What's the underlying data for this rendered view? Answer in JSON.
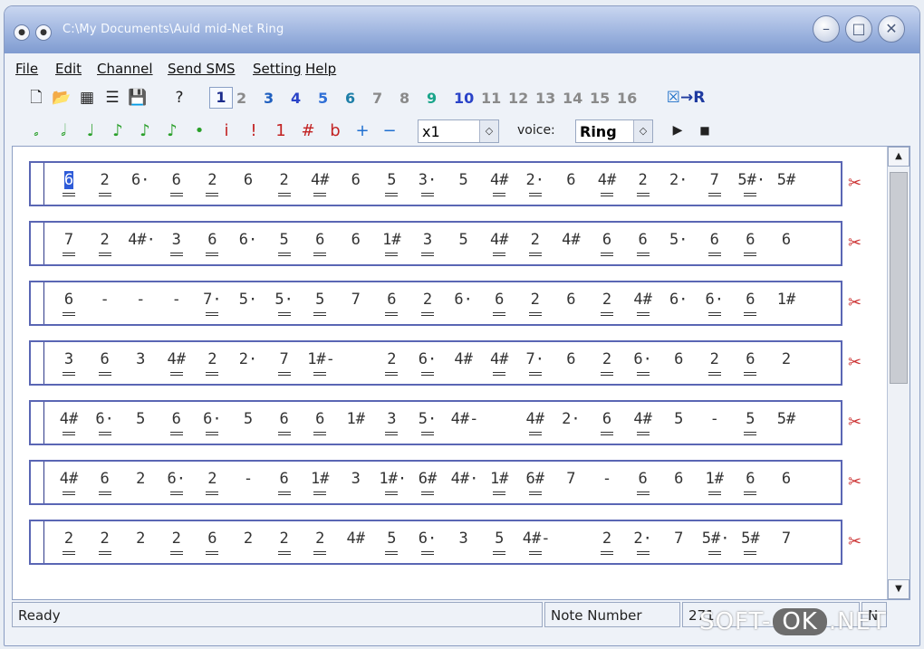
{
  "window": {
    "title": "C:\\My Documents\\Auld mid-Net Ring"
  },
  "menu": [
    "File",
    "Edit",
    "Channel",
    "Send SMS",
    "Setting",
    "Help"
  ],
  "toolbar": {
    "icons": [
      "new-icon",
      "open-icon",
      "calendar-icon",
      "list-icon",
      "save-icon",
      "help-icon"
    ],
    "channels": [
      {
        "label": "1",
        "color": "#1c2c8c"
      },
      {
        "label": "2",
        "color": "#8a8a8a"
      },
      {
        "label": "3",
        "color": "#1f5fbf"
      },
      {
        "label": "4",
        "color": "#2a43c8"
      },
      {
        "label": "5",
        "color": "#2f6fd6"
      },
      {
        "label": "6",
        "color": "#1e7fa8"
      },
      {
        "label": "7",
        "color": "#8a8a8a"
      },
      {
        "label": "8",
        "color": "#8a8a8a"
      },
      {
        "label": "9",
        "color": "#1aa58a"
      },
      {
        "label": "10",
        "color": "#2a43c8"
      },
      {
        "label": "11",
        "color": "#8a8a8a"
      },
      {
        "label": "12",
        "color": "#8a8a8a"
      },
      {
        "label": "13",
        "color": "#8a8a8a"
      },
      {
        "label": "14",
        "color": "#8a8a8a"
      },
      {
        "label": "15",
        "color": "#8a8a8a"
      },
      {
        "label": "16",
        "color": "#8a8a8a"
      }
    ],
    "transfer_label": "→R"
  },
  "notes_toolbar": {
    "note_symbols": [
      "𝅗",
      "𝅗𝅥",
      "♩",
      "♪",
      "♪",
      "♪",
      "•",
      "i",
      "!",
      "1",
      "#",
      "b",
      "+",
      "−"
    ],
    "note_colors": [
      "#2aa02a",
      "#2aa02a",
      "#2aa02a",
      "#2aa02a",
      "#2aa02a",
      "#2aa02a",
      "#2aa02a",
      "#c22222",
      "#c22222",
      "#c22222",
      "#c22222",
      "#c22222",
      "#1f6fd0",
      "#1f6fd0"
    ],
    "multiplier": "x1",
    "voice_label": "voice:",
    "voice_value": "Ring"
  },
  "score": {
    "rows": [
      [
        "6",
        "2",
        "6·",
        "6",
        "2",
        "6",
        "2",
        "4#",
        "6",
        "5",
        "3·",
        "5",
        "4#",
        "2·",
        "6",
        "4#",
        "2",
        "2·",
        "7",
        "5#·",
        "5#"
      ],
      [
        "7",
        "2",
        "4#·",
        "3",
        "6",
        "6·",
        "5",
        "6",
        "6",
        "1#",
        "3",
        "5",
        "4#",
        "2",
        "4#",
        "6",
        "6",
        "5·",
        "6",
        "6",
        "6"
      ],
      [
        "6",
        "-",
        "-",
        "-",
        "7·",
        "5·",
        "5·",
        "5",
        "7",
        "6",
        "2",
        "6·",
        "6",
        "2",
        "6",
        "2",
        "4#",
        "6·",
        "6·",
        "6",
        "1#"
      ],
      [
        "3",
        "6",
        "3",
        "4#",
        "2",
        "2·",
        "7",
        "1#-",
        "",
        "2",
        "6·",
        "4#",
        "4#",
        "7·",
        "6",
        "2",
        "6·",
        "6",
        "2",
        "6",
        "2"
      ],
      [
        "4#",
        "6·",
        "5",
        "6",
        "6·",
        "5",
        "6",
        "6",
        "1#",
        "3",
        "5·",
        "4#-",
        "",
        "4#",
        "2·",
        "6",
        "4#",
        "5",
        "-",
        "5",
        "5#"
      ],
      [
        "4#",
        "6",
        "2",
        "6·",
        "2",
        "-",
        "6",
        "1#",
        "3",
        "1#·",
        "6#",
        "4#·",
        "1#",
        "6#",
        "7",
        "-",
        "6",
        "6",
        "1#",
        "6",
        "6"
      ],
      [
        "2",
        "2",
        "2",
        "2",
        "6",
        "2",
        "2",
        "2",
        "4#",
        "5",
        "6·",
        "3",
        "5",
        "4#-",
        "",
        "2",
        "2·",
        "7",
        "5#·",
        "5#",
        "7"
      ]
    ]
  },
  "status": {
    "state": "Ready",
    "label": "Note Number",
    "value": "271",
    "mode": "N"
  },
  "watermark": {
    "left": "SOFT-",
    "pill": "OK",
    "right": ".NET"
  }
}
